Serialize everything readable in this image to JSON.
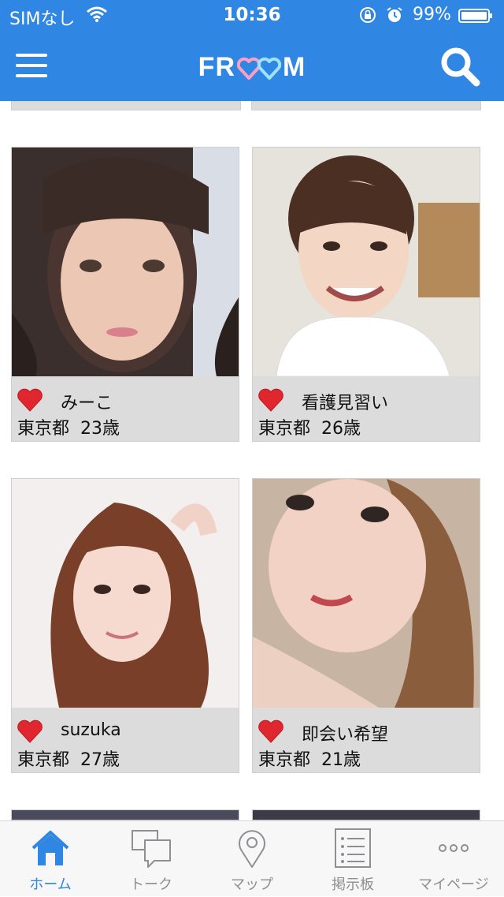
{
  "status_bar": {
    "carrier": "SIMなし",
    "time": "10:36",
    "battery_percent": "99%"
  },
  "header": {
    "logo_left": "FR",
    "logo_right": "M"
  },
  "colors": {
    "accent": "#2f86e3",
    "card_bg": "#dcdcdc",
    "heart": "#e0262e",
    "inactive": "#8e8e93"
  },
  "profiles": [
    {
      "name": "みーこ",
      "location": "東京都",
      "age": "23歳"
    },
    {
      "name": "看護見習い",
      "location": "東京都",
      "age": "26歳"
    },
    {
      "name": "suzuka",
      "location": "東京都",
      "age": "27歳"
    },
    {
      "name": "即会い希望",
      "location": "東京都",
      "age": "21歳"
    }
  ],
  "tabs": [
    {
      "label": "ホーム",
      "icon": "home-icon",
      "active": true
    },
    {
      "label": "トーク",
      "icon": "talk-icon",
      "active": false
    },
    {
      "label": "マップ",
      "icon": "map-pin-icon",
      "active": false
    },
    {
      "label": "掲示板",
      "icon": "board-icon",
      "active": false
    },
    {
      "label": "マイページ",
      "icon": "more-icon",
      "active": false
    }
  ]
}
